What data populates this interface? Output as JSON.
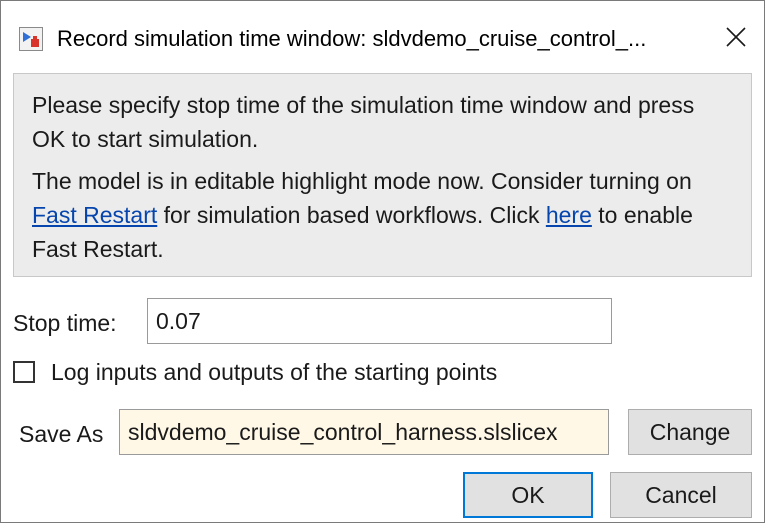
{
  "window": {
    "title": "Record simulation time window: sldvdemo_cruise_control_...",
    "app_icon": "simulink-record-icon",
    "close_icon": "close-icon"
  },
  "info": {
    "line1": "Please specify stop time of the simulation time window and press OK to start simulation.",
    "line2_part1": "The model is in editable highlight mode now. Consider turning on ",
    "fast_restart_link": "Fast Restart",
    "line2_part2": " for simulation based workflows. Click ",
    "here_link": "here",
    "line2_part3": " to enable Fast Restart."
  },
  "stop_time": {
    "label": "Stop time:",
    "value": "0.07"
  },
  "log_option": {
    "label": "Log inputs and outputs of the starting points",
    "checked": false
  },
  "save_as": {
    "label": "Save As",
    "value": "sldvdemo_cruise_control_harness.slslicex",
    "change_label": "Change"
  },
  "buttons": {
    "ok_label": "OK",
    "cancel_label": "Cancel"
  },
  "colors": {
    "link": "#0645ad",
    "panel_bg": "#ececec",
    "save_field_bg": "#fff8e7",
    "focus_border": "#0078d7"
  }
}
